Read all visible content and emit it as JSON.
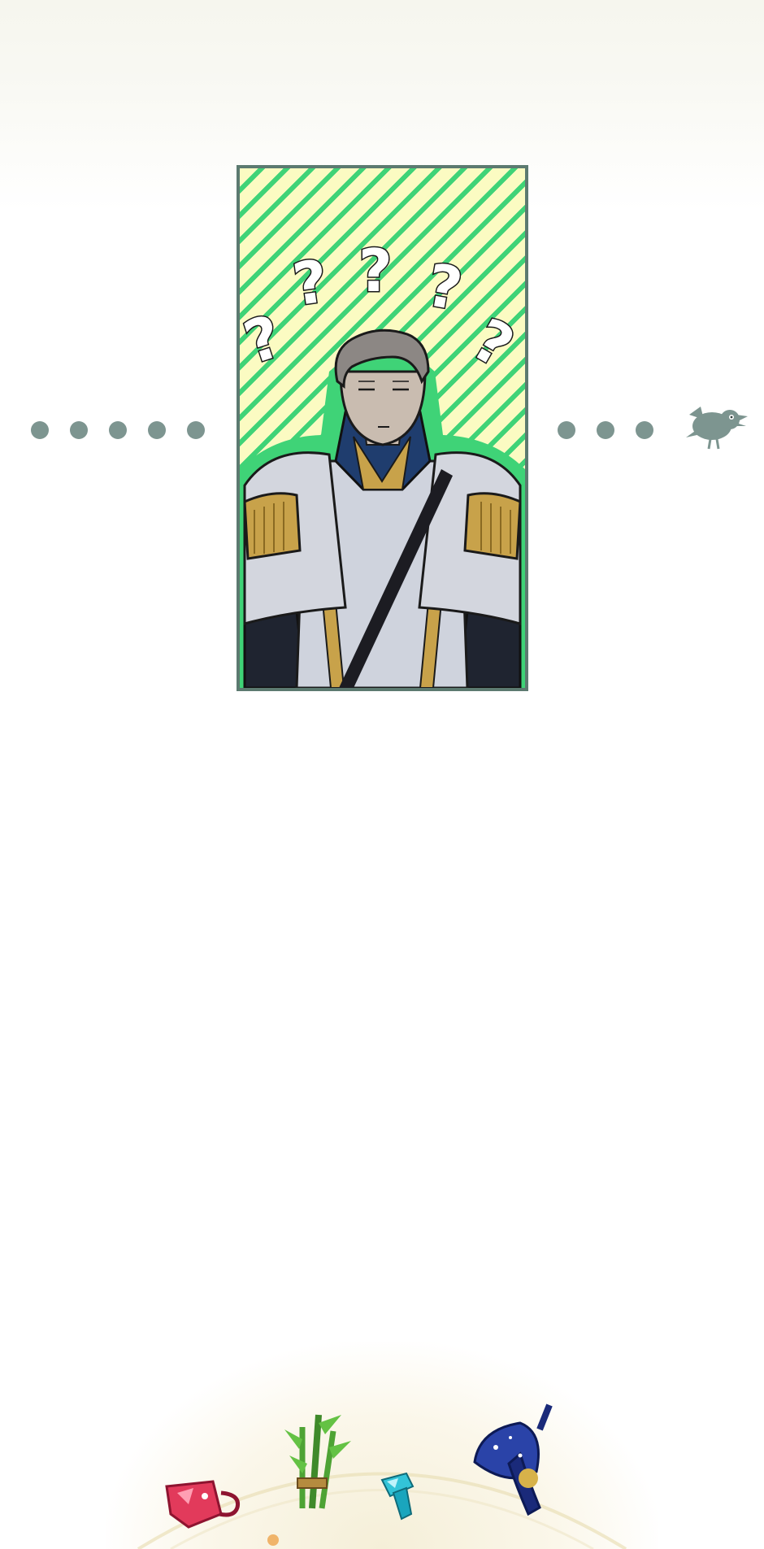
{
  "page": {
    "background": "#ffffff",
    "panel_stripe_colors": [
      "#fbfbc2",
      "#3fd377"
    ],
    "panel_border_color": "#5c7a70"
  },
  "panel": {
    "character": "uniformed-officer",
    "question_marks": [
      "?",
      "?",
      "?",
      "?",
      "?"
    ]
  },
  "left_dots": 5,
  "right_dots": 3,
  "icons": [
    "crow-icon",
    "gem-cup-icon",
    "herb-bundle-icon",
    "crystal-icon",
    "star-hat-icon"
  ]
}
